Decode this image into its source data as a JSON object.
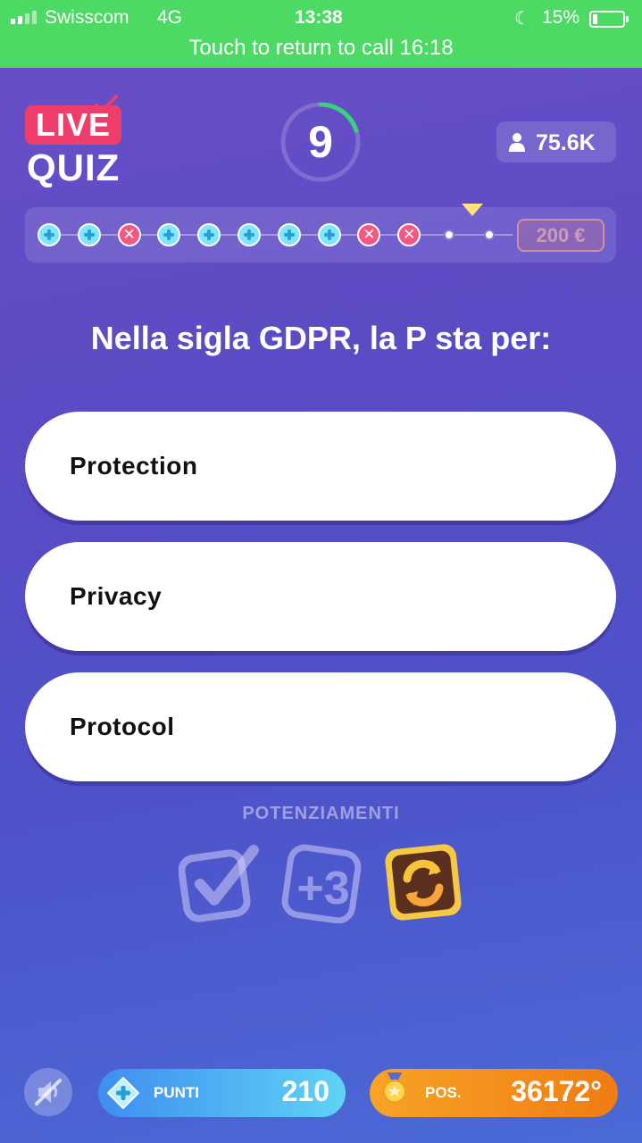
{
  "status_bar": {
    "carrier": "Swisscom",
    "network": "4G",
    "time": "13:38",
    "battery": "15%",
    "call_banner": "Touch to return to call 16:18"
  },
  "header": {
    "logo_live": "LIVE",
    "logo_quiz": "QUIZ",
    "timer_value": "9",
    "timer_remaining_fraction": 0.2,
    "viewers": "75.6K"
  },
  "progress": {
    "marks": [
      "ok",
      "ok",
      "bad",
      "ok",
      "ok",
      "ok",
      "ok",
      "ok",
      "bad",
      "bad",
      "pending",
      "pending"
    ],
    "current_index": 10,
    "prize": "200 €"
  },
  "question": {
    "text": "Nella sigla GDPR, la P sta per:",
    "answers": [
      "Protection",
      "Privacy",
      "Protocol"
    ]
  },
  "powerups": {
    "label": "POTENZIAMENTI",
    "items": [
      {
        "icon": "checkmark-icon",
        "enabled": false
      },
      {
        "icon": "plus-three-icon",
        "text": "+3",
        "enabled": false
      },
      {
        "icon": "swap-icon",
        "enabled": true
      }
    ]
  },
  "footer": {
    "points_label": "PUNTI",
    "points_value": "210",
    "position_label": "POS.",
    "position_value": "36172°"
  },
  "colors": {
    "status_green": "#4cd964",
    "live_pink": "#ef3e6c",
    "timer_green": "#37d27a",
    "points_blue": "#3e8ef0",
    "position_orange": "#f8a326"
  }
}
